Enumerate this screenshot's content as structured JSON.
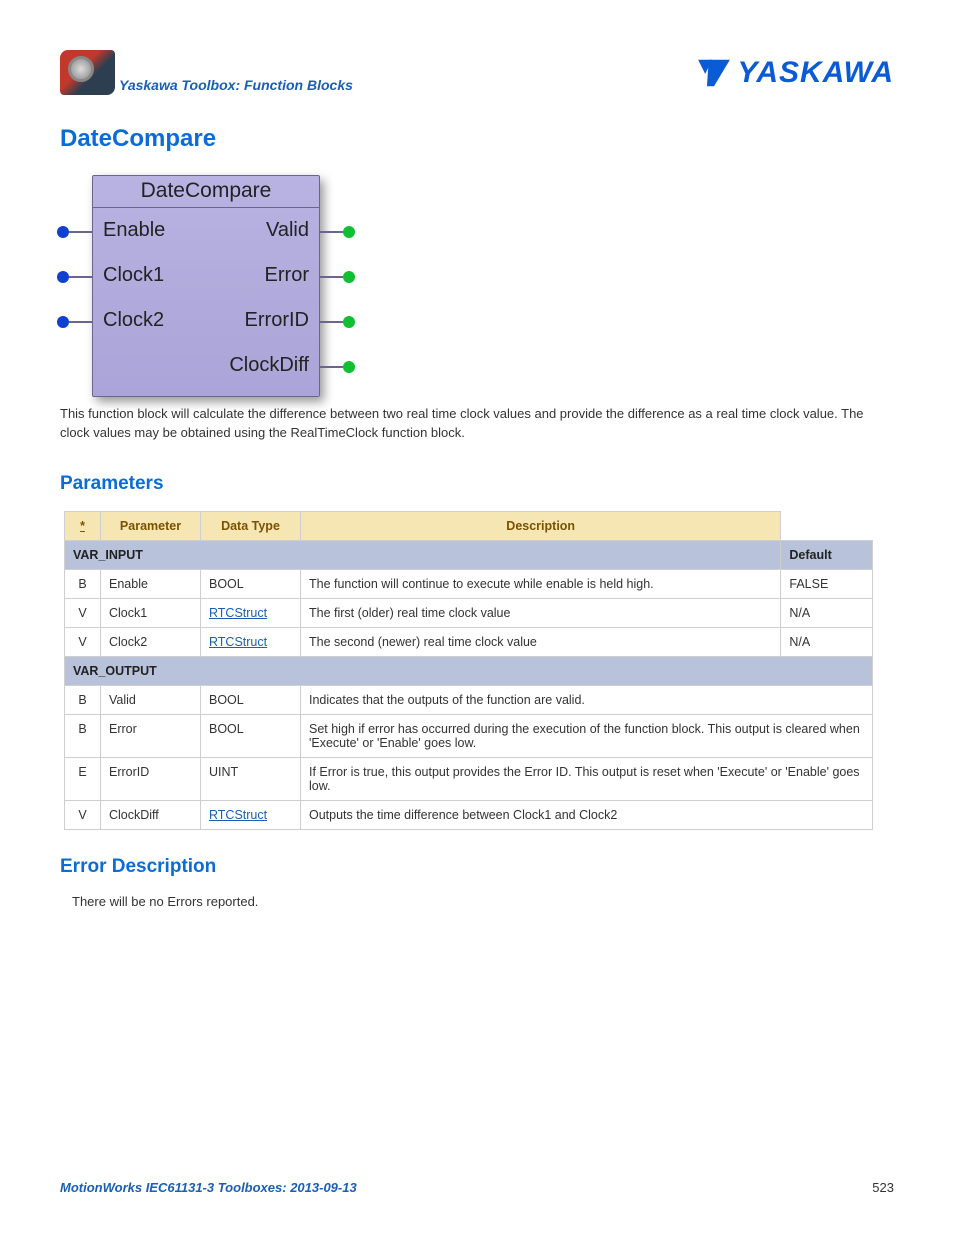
{
  "header": {
    "breadcrumb": "Yaskawa Toolbox: Function Blocks",
    "brand": "YASKAWA"
  },
  "title": "DateCompare",
  "function_block": {
    "name": "DateCompare",
    "inputs": [
      "Enable",
      "Clock1",
      "Clock2"
    ],
    "outputs": [
      "Valid",
      "Error",
      "ErrorID",
      "ClockDiff"
    ]
  },
  "description": "This function block will calculate the difference between two real time clock values and provide the difference as a real time clock value.  The clock values may be obtained using the RealTimeClock function block.",
  "params": {
    "heading": "Parameters",
    "columns": {
      "flag": "*",
      "param": "Parameter",
      "type": "Data Type",
      "desc": "Description",
      "default": "Default"
    },
    "var_input_label": "VAR_INPUT",
    "var_output_label": "VAR_OUTPUT",
    "inputs": [
      {
        "flag": "B",
        "name": "Enable",
        "type": "BOOL",
        "type_link": false,
        "desc": "The function will continue to execute while enable is held high.",
        "default": "FALSE"
      },
      {
        "flag": "V",
        "name": "Clock1",
        "type": "RTCStruct",
        "type_link": true,
        "desc": "The first (older) real time clock value",
        "default": "N/A"
      },
      {
        "flag": "V",
        "name": "Clock2",
        "type": "RTCStruct",
        "type_link": true,
        "desc": "The second (newer) real time clock value",
        "default": "N/A"
      }
    ],
    "outputs": [
      {
        "flag": "B",
        "name": "Valid",
        "type": "BOOL",
        "type_link": false,
        "desc": "Indicates that the outputs of the function are valid."
      },
      {
        "flag": "B",
        "name": "Error",
        "type": "BOOL",
        "type_link": false,
        "desc": "Set high if error has occurred during the execution of the function block. This output is cleared when 'Execute' or 'Enable' goes low."
      },
      {
        "flag": "E",
        "name": "ErrorID",
        "type": "UINT",
        "type_link": false,
        "desc": "If Error is true, this output provides the Error ID. This output is reset when 'Execute' or 'Enable' goes low."
      },
      {
        "flag": "V",
        "name": "ClockDiff",
        "type": "RTCStruct",
        "type_link": true,
        "desc": "Outputs the time difference between Clock1 and Clock2"
      }
    ]
  },
  "error_section": {
    "heading": "Error Description",
    "text": "There will be no Errors reported."
  },
  "footer": {
    "left": "MotionWorks IEC61131-3 Toolboxes: 2013-09-13",
    "page": "523"
  }
}
